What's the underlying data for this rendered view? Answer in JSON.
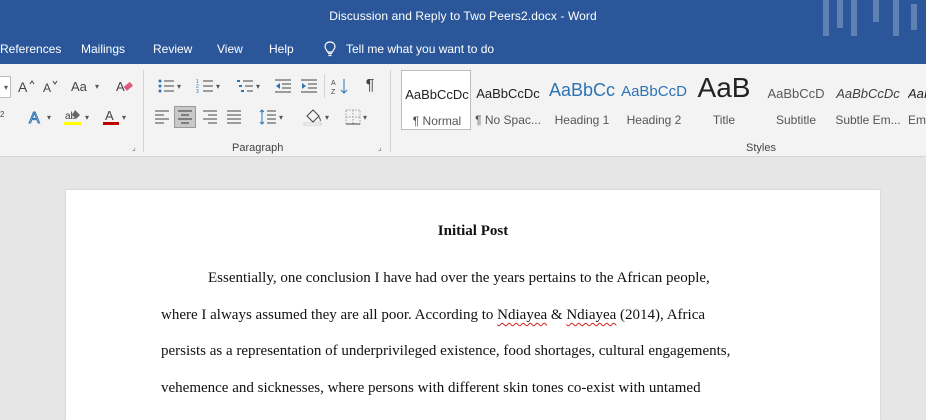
{
  "window": {
    "title": "Discussion and Reply to Two Peers2.docx  -  Word"
  },
  "menu": {
    "tabs": [
      "References",
      "Mailings",
      "Review",
      "View",
      "Help"
    ],
    "tell_me": "Tell me what you want to do"
  },
  "ribbon": {
    "paragraph_label": "Paragraph",
    "styles_label": "Styles",
    "styles": [
      {
        "sample": "AaBbCcDc",
        "name": "¶ Normal"
      },
      {
        "sample": "AaBbCcDc",
        "name": "¶ No Spac..."
      },
      {
        "sample": "AaBbCc",
        "name": "Heading 1"
      },
      {
        "sample": "AaBbCcD",
        "name": "Heading 2"
      },
      {
        "sample": "AaB",
        "name": "Title"
      },
      {
        "sample": "AaBbCcD",
        "name": "Subtitle"
      },
      {
        "sample": "AaBbCcDc",
        "name": "Subtle Em..."
      },
      {
        "sample": "AaI",
        "name": "Em"
      }
    ],
    "style_colors": {
      "heading": "#2e74b5",
      "text": "#222222",
      "subtle": "#595959"
    }
  },
  "document": {
    "heading": "Initial Post",
    "lines": [
      "Essentially, one conclusion I have had over the years pertains to the African people,",
      "where I always assumed they are all poor. According to ",
      "persists as a representation of underprivileged existence, food shortages, cultural engagements,",
      "vehemence and sicknesses, where persons with different skin tones co-exist with untamed"
    ],
    "citation": {
      "author1": "Ndiayea",
      "amp": " & ",
      "author2": "Ndiayea",
      "rest": " (2014), Africa"
    }
  },
  "colors": {
    "title_bar": "#2b579a",
    "ribbon": "#f3f3f3",
    "canvas": "#e6e6e6",
    "font_color_red": "#c00000",
    "highlight_yellow": "#ffff00"
  }
}
